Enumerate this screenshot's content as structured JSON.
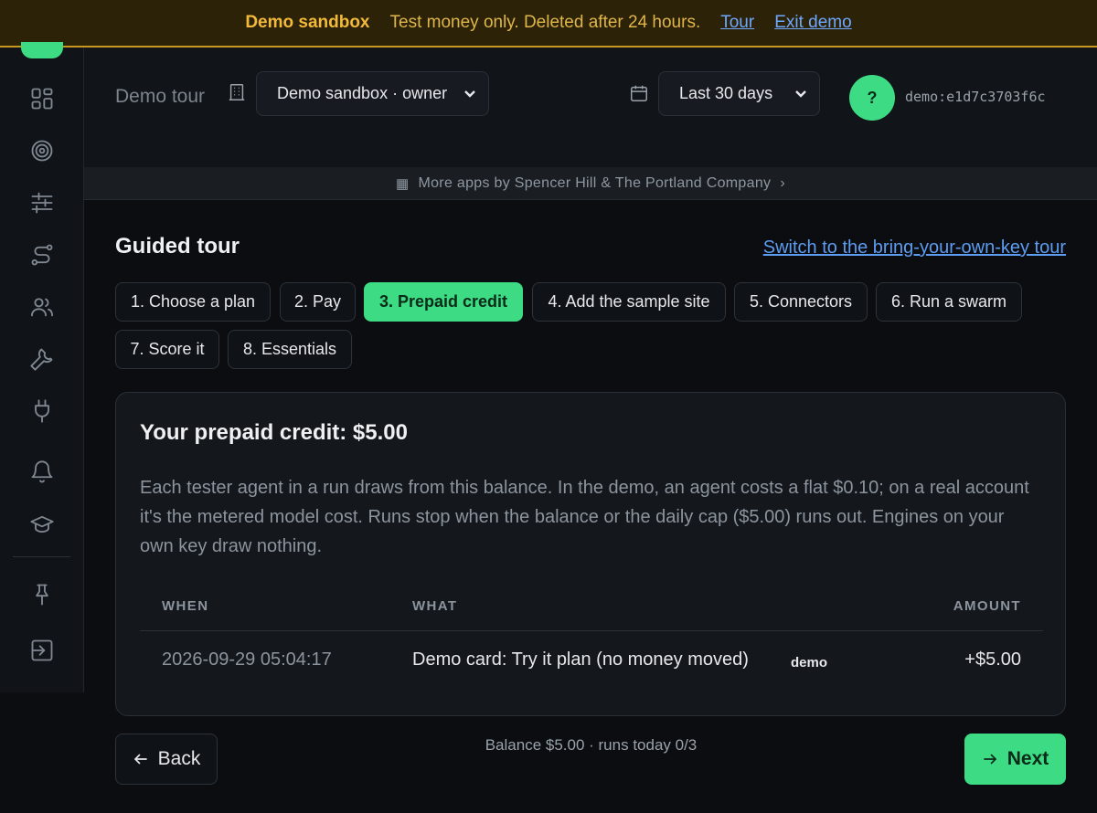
{
  "banner": {
    "title": "Demo sandbox",
    "message": "Test money only. Deleted after 24 hours.",
    "tour_link": "Tour",
    "exit_link": "Exit demo"
  },
  "sidebar": {
    "icons": [
      "dashboard-icon",
      "target-icon",
      "sliders-icon",
      "route-icon",
      "users-icon",
      "wrench-icon",
      "plug-icon",
      "bell-icon",
      "graduation-cap-icon",
      "pin-icon",
      "sign-in-icon"
    ]
  },
  "header": {
    "title": "Demo tour",
    "workspace_select": "Demo sandbox · owner",
    "date_range_select": "Last 30 days",
    "avatar_initial": "?",
    "user_id": "demo:e1d7c3703f6c"
  },
  "apps_strip": {
    "text": "More apps by Spencer Hill & The Portland Company",
    "chevron": "›"
  },
  "tour": {
    "title": "Guided tour",
    "byok_link": "Switch to the bring-your-own-key tour",
    "steps": [
      {
        "label": "1. Choose a plan",
        "active": false
      },
      {
        "label": "2. Pay",
        "active": false
      },
      {
        "label": "3. Prepaid credit",
        "active": true
      },
      {
        "label": "4. Add the sample site",
        "active": false
      },
      {
        "label": "5. Connectors",
        "active": false
      },
      {
        "label": "6. Run a swarm",
        "active": false
      },
      {
        "label": "7. Score it",
        "active": false
      },
      {
        "label": "8. Essentials",
        "active": false
      }
    ]
  },
  "credit_card": {
    "title": "Your prepaid credit: $5.00",
    "description": "Each tester agent in a run draws from this balance. In the demo, an agent costs a flat $0.10; on a real account it's the metered model cost. Runs stop when the balance or the daily cap ($5.00) runs out. Engines on your own key draw nothing.",
    "table": {
      "headers": {
        "when": "WHEN",
        "what": "WHAT",
        "amount": "AMOUNT"
      },
      "rows": [
        {
          "when": "2026-09-29 05:04:17",
          "what": "Demo card: Try it plan (no money moved)",
          "badge": "demo",
          "amount": "+$5.00"
        }
      ]
    }
  },
  "footer": {
    "back_label": "Back",
    "status": "Balance $5.00 · runs today 0/3",
    "next_label": "Next"
  },
  "colors": {
    "accent": "#3ddc84",
    "banner_bg": "#2b2208",
    "banner_text": "#f2b93b",
    "link": "#5d9cf0"
  }
}
